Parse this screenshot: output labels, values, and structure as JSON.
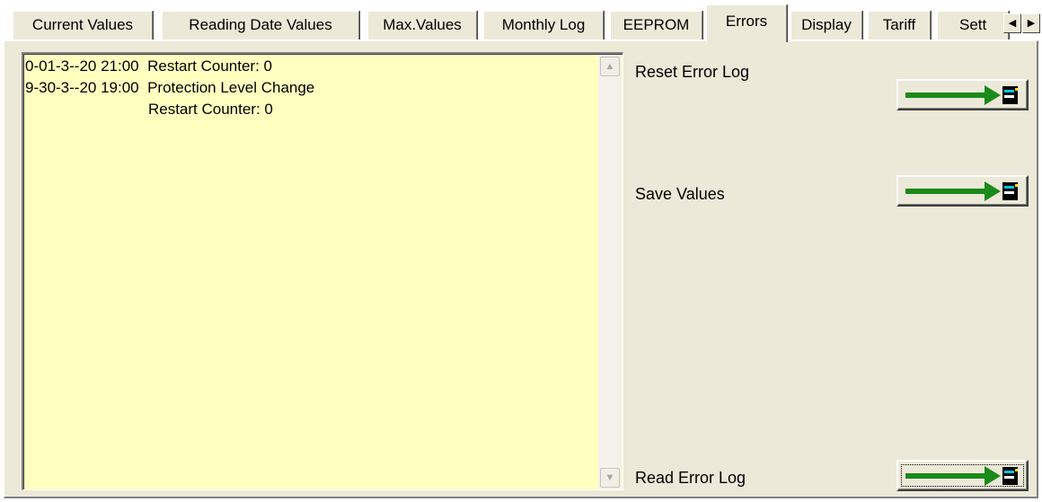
{
  "tabs": [
    {
      "label": "Current Values",
      "active": false
    },
    {
      "label": "Reading Date Values",
      "active": false
    },
    {
      "label": "Max.Values",
      "active": false
    },
    {
      "label": "Monthly Log",
      "active": false
    },
    {
      "label": "EEPROM",
      "active": false
    },
    {
      "label": "Errors",
      "active": true
    },
    {
      "label": "Display",
      "active": false
    },
    {
      "label": "Tariff",
      "active": false
    },
    {
      "label": "Sett",
      "active": false
    }
  ],
  "tab_scroll": {
    "left_icon": "triangle-left-icon",
    "right_icon": "triangle-right-icon"
  },
  "error_log": {
    "lines": [
      "0-01-3--20 21:00  Restart Counter: 0",
      "9-30-3--20 19:00  Protection Level Change",
      "                             Restart Counter: 0"
    ]
  },
  "actions": {
    "reset_label": "Reset Error Log",
    "save_label": "Save Values",
    "read_label": "Read Error Log",
    "button_icon": "arrow-to-device-icon"
  },
  "colors": {
    "log_background": "#ffffc0",
    "panel": "#ece9d8",
    "arrow": "#1a8a1a",
    "device_accent": "#00c8e0"
  }
}
